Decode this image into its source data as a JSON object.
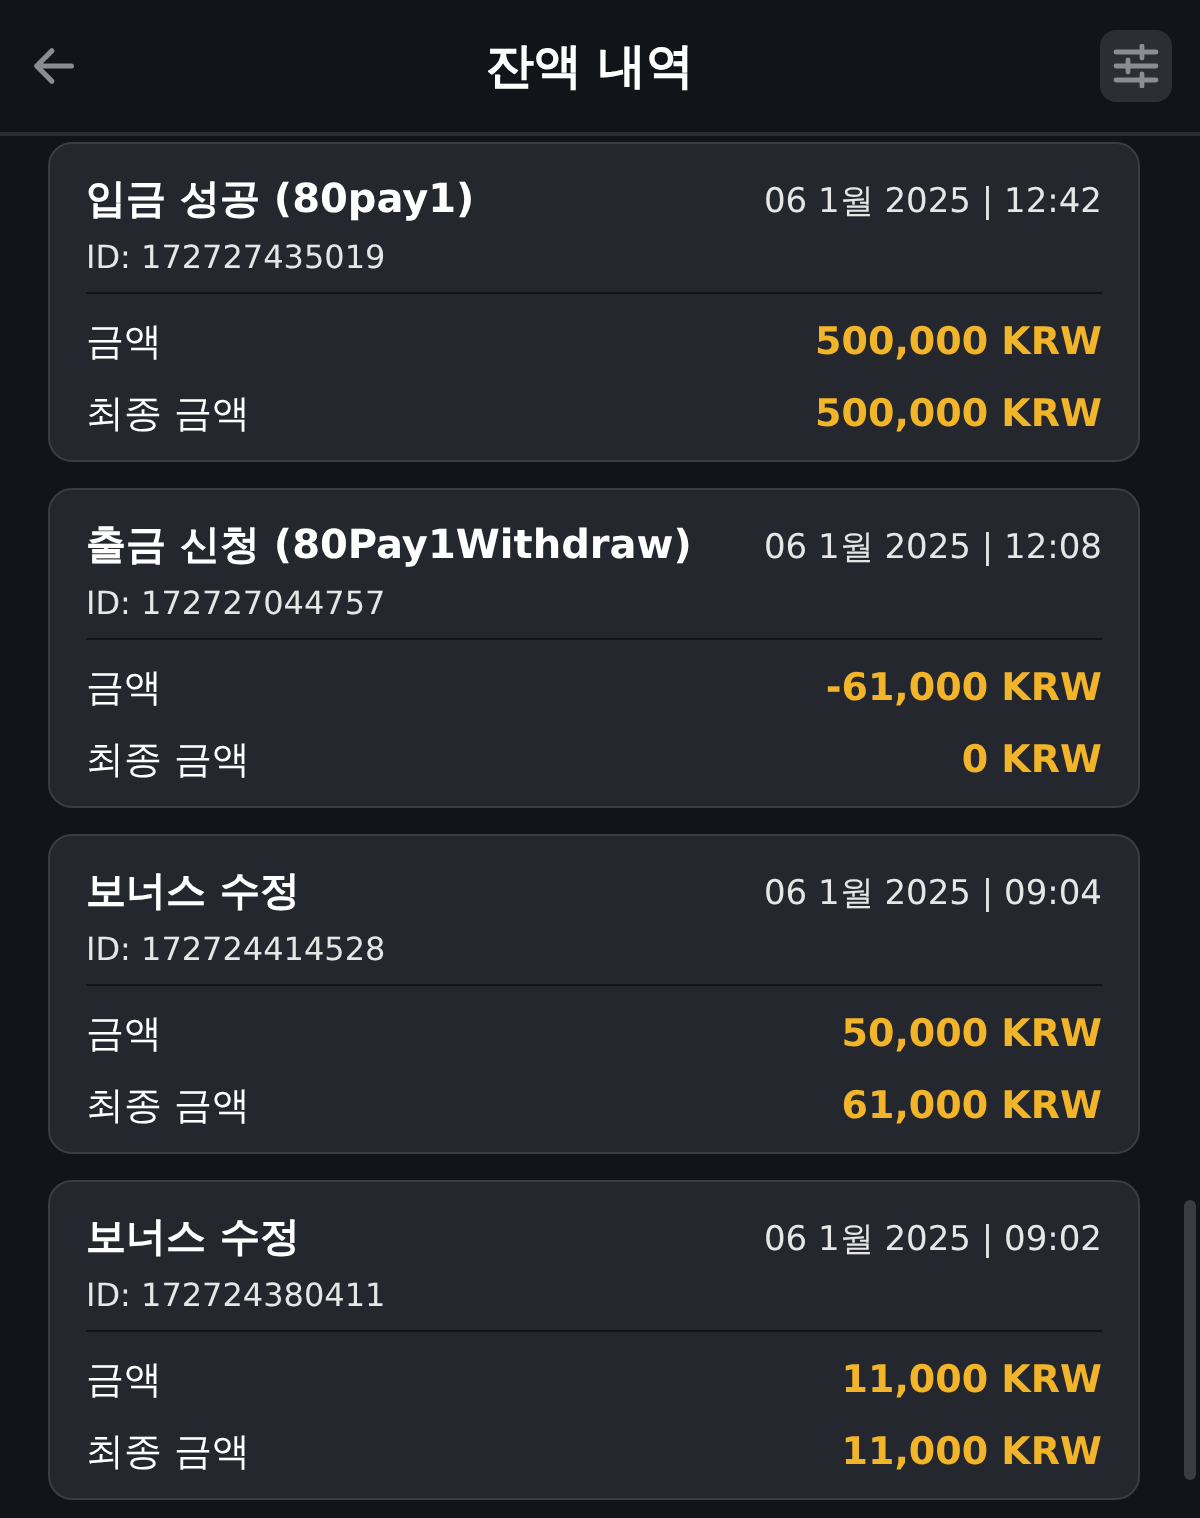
{
  "header": {
    "title": "잔액 내역"
  },
  "transactions": [
    {
      "title": "입금 성공 (80pay1)",
      "datetime": "06 1월 2025 | 12:42",
      "id": "ID: 172727435019",
      "rows": [
        {
          "label": "금액",
          "value": "500,000 KRW"
        },
        {
          "label": "최종 금액",
          "value": "500,000 KRW"
        }
      ]
    },
    {
      "title": "출금 신청 (80Pay1Withdraw)",
      "datetime": "06 1월 2025 | 12:08",
      "id": "ID: 172727044757",
      "rows": [
        {
          "label": "금액",
          "value": "-61,000 KRW"
        },
        {
          "label": "최종 금액",
          "value": "0 KRW"
        }
      ]
    },
    {
      "title": "보너스 수정",
      "datetime": "06 1월 2025 | 09:04",
      "id": "ID: 172724414528",
      "rows": [
        {
          "label": "금액",
          "value": "50,000 KRW"
        },
        {
          "label": "최종 금액",
          "value": "61,000 KRW"
        }
      ]
    },
    {
      "title": "보너스 수정",
      "datetime": "06 1월 2025 | 09:02",
      "id": "ID: 172724380411",
      "rows": [
        {
          "label": "금액",
          "value": "11,000 KRW"
        },
        {
          "label": "최종 금액",
          "value": "11,000 KRW"
        }
      ]
    }
  ]
}
